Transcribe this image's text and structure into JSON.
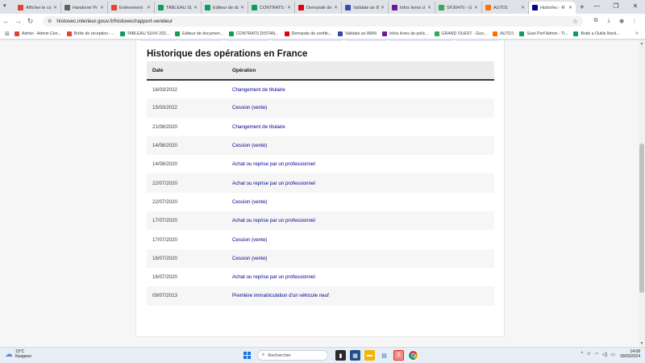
{
  "browser": {
    "tabs": [
      {
        "label": "Afficher le co",
        "color": "#db4437"
      },
      {
        "label": "Handover Pr",
        "color": "#5f6368"
      },
      {
        "label": "Enlèvement",
        "color": "#ea4335"
      },
      {
        "label": "TABLEAU SUIV",
        "color": "#0f9d58"
      },
      {
        "label": "Editeur de do",
        "color": "#0f9d58"
      },
      {
        "label": "CONTRATS D",
        "color": "#0f9d58"
      },
      {
        "label": "Demande de",
        "color": "#e1000f"
      },
      {
        "label": "Validate an IB",
        "color": "#3949ab"
      },
      {
        "label": "Infos livres d",
        "color": "#6a1b9a"
      },
      {
        "label": "SF30470 - G",
        "color": "#34a853"
      },
      {
        "label": "AUTO1",
        "color": "#ff6f00"
      },
      {
        "label": "HistoVec - R",
        "color": "#000091",
        "active": true
      }
    ],
    "url": "histovec.interieur.gouv.fr/histovec/rapport-vendeur",
    "bookmarks": [
      {
        "label": "Admin - Admin Cen...",
        "color": "#db4437"
      },
      {
        "label": "Boîte de réception -...",
        "color": "#ea4335"
      },
      {
        "label": "TABLEAU SUIVI 202...",
        "color": "#0f9d58"
      },
      {
        "label": "Editeur de documen...",
        "color": "#0f9d58"
      },
      {
        "label": "CONTRATS DISTAN...",
        "color": "#0f9d58"
      },
      {
        "label": "Demande de certific...",
        "color": "#e1000f"
      },
      {
        "label": "Validate an IBAN",
        "color": "#3949ab"
      },
      {
        "label": "Infos livres de polic...",
        "color": "#6a1b9a"
      },
      {
        "label": "GRAND OUEST - Goo...",
        "color": "#34a853"
      },
      {
        "label": "AUTO1",
        "color": "#ff6f00"
      },
      {
        "label": "Suivi Perf Admin - Ti...",
        "color": "#0f9d58"
      },
      {
        "label": "Boite a Outils Nord...",
        "color": "#0f9d58"
      }
    ]
  },
  "page": {
    "section_title": "Historique des opérations en France",
    "columns": {
      "date": "Date",
      "operation": "Opération"
    },
    "rows": [
      {
        "date": "16/03/2022",
        "operation": "Changement de titulaire"
      },
      {
        "date": "15/03/2022",
        "operation": "Cession (vente)"
      },
      {
        "date": "21/08/2020",
        "operation": "Changement de titulaire"
      },
      {
        "date": "14/08/2020",
        "operation": "Cession (vente)"
      },
      {
        "date": "14/08/2020",
        "operation": "Achat ou reprise par un professionnel"
      },
      {
        "date": "22/07/2020",
        "operation": "Achat ou reprise par un professionnel"
      },
      {
        "date": "22/07/2020",
        "operation": "Cession (vente)"
      },
      {
        "date": "17/07/2020",
        "operation": "Achat ou reprise par un professionnel"
      },
      {
        "date": "17/07/2020",
        "operation": "Cession (vente)"
      },
      {
        "date": "16/07/2020",
        "operation": "Cession (vente)"
      },
      {
        "date": "16/07/2020",
        "operation": "Achat ou reprise par un professionnel"
      },
      {
        "date": "09/07/2013",
        "operation": "Première immatriculation d'un véhicule neuf"
      }
    ]
  },
  "taskbar": {
    "weather_temp": "13°C",
    "weather_desc": "Nuageux",
    "search_placeholder": "Rechercher",
    "time": "14:08",
    "date": "30/03/2024"
  }
}
